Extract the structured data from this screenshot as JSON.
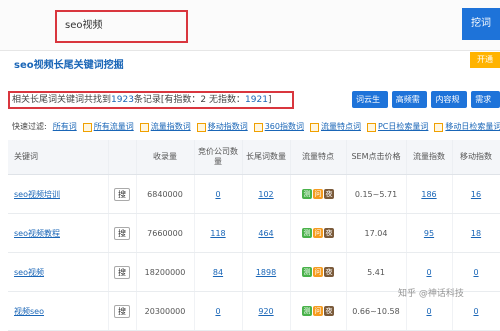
{
  "search": {
    "value": "seo视频",
    "button": "挖词"
  },
  "title": {
    "keyword": "seo视频",
    "rest": "长尾关键词挖掘"
  },
  "corner_button": "开通",
  "summary": {
    "prefix": "相关长尾词关键词共找到",
    "count": "1923",
    "mid": "条记录[有指数：2  无指数：",
    "noindex": "1921",
    "suffix": "]"
  },
  "actions": [
    "词云生成",
    "高频需求",
    "内容规划",
    "需求图"
  ],
  "filters": {
    "label": "快速过滤:",
    "items": [
      "所有词",
      "所有流量词",
      "流量指数词",
      "移动指数词",
      "360指数词",
      "流量特点词",
      "PC日检索量词",
      "移动日检索量词"
    ]
  },
  "table": {
    "headers": [
      "关键词",
      "",
      "收录量",
      "竞价公司数量",
      "长尾词数量",
      "流量特点",
      "SEM点击价格",
      "流量指数",
      "移动指数"
    ],
    "rows": [
      {
        "keyword": "seo视频培训",
        "search": "搜",
        "indexed": "6840000",
        "competitors": "0",
        "longtail": "102",
        "sem": "0.15~5.71",
        "flow": "186",
        "mobile": "16"
      },
      {
        "keyword": "seo视频教程",
        "search": "搜",
        "indexed": "7660000",
        "competitors": "118",
        "longtail": "464",
        "sem": "17.04",
        "flow": "95",
        "mobile": "18"
      },
      {
        "keyword": "seo视频",
        "search": "搜",
        "indexed": "18200000",
        "competitors": "84",
        "longtail": "1898",
        "sem": "5.41",
        "flow": "0",
        "mobile": "0"
      },
      {
        "keyword": "视频seo",
        "search": "搜",
        "indexed": "20300000",
        "competitors": "0",
        "longtail": "920",
        "sem": "0.66~10.58",
        "flow": "0",
        "mobile": "0"
      }
    ],
    "tags": [
      "测",
      "问",
      "夜"
    ]
  },
  "watermark": "知乎 @神话科技"
}
